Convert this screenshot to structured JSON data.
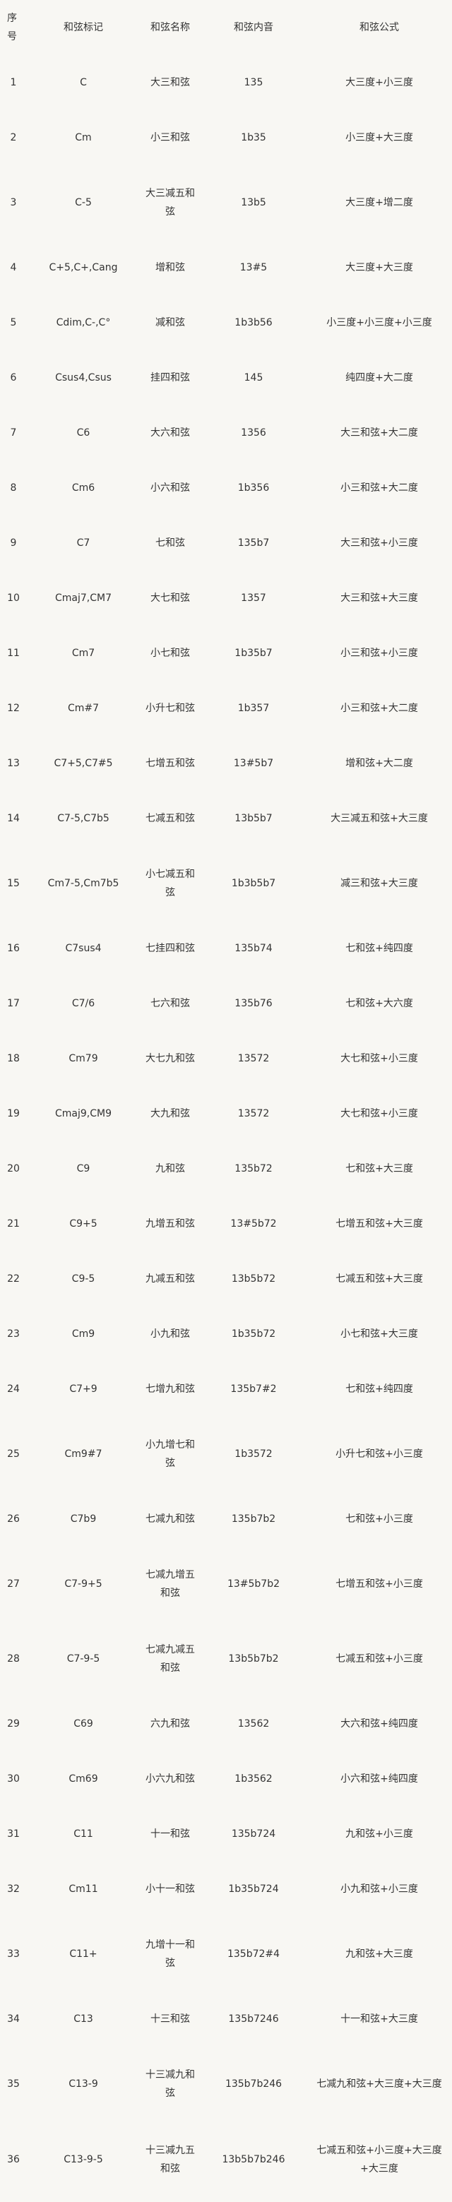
{
  "headers": {
    "num": "序号",
    "mark": "和弦标记",
    "name": "和弦名称",
    "tones": "和弦内音",
    "formula": "和弦公式"
  },
  "rows": [
    {
      "num": "1",
      "mark": "C",
      "name": "大三和弦",
      "tones": "135",
      "formula": "大三度+小三度"
    },
    {
      "num": "2",
      "mark": "Cm",
      "name": "小三和弦",
      "tones": "1b35",
      "formula": "小三度+大三度"
    },
    {
      "num": "3",
      "mark": "C-5",
      "name": "大三减五和弦",
      "tones": "13b5",
      "formula": "大三度+增二度"
    },
    {
      "num": "4",
      "mark": "C+5,C+,Cang",
      "name": "增和弦",
      "tones": "13#5",
      "formula": "大三度+大三度"
    },
    {
      "num": "5",
      "mark": "Cdim,C-,C°",
      "name": "减和弦",
      "tones": "1b3b56",
      "formula": "小三度+小三度+小三度"
    },
    {
      "num": "6",
      "mark": "Csus4,Csus",
      "name": "挂四和弦",
      "tones": "145",
      "formula": "纯四度+大二度"
    },
    {
      "num": "7",
      "mark": "C6",
      "name": "大六和弦",
      "tones": "1356",
      "formula": "大三和弦+大二度"
    },
    {
      "num": "8",
      "mark": "Cm6",
      "name": "小六和弦",
      "tones": "1b356",
      "formula": "小三和弦+大二度"
    },
    {
      "num": "9",
      "mark": "C7",
      "name": "七和弦",
      "tones": "135b7",
      "formula": "大三和弦+小三度"
    },
    {
      "num": "10",
      "mark": "Cmaj7,CM7",
      "name": "大七和弦",
      "tones": "1357",
      "formula": "大三和弦+大三度"
    },
    {
      "num": "11",
      "mark": "Cm7",
      "name": "小七和弦",
      "tones": "1b35b7",
      "formula": "小三和弦+小三度"
    },
    {
      "num": "12",
      "mark": "Cm#7",
      "name": "小升七和弦",
      "tones": "1b357",
      "formula": "小三和弦+大二度"
    },
    {
      "num": "13",
      "mark": "C7+5,C7#5",
      "name": "七增五和弦",
      "tones": "13#5b7",
      "formula": "增和弦+大二度"
    },
    {
      "num": "14",
      "mark": "C7-5,C7b5",
      "name": "七减五和弦",
      "tones": "13b5b7",
      "formula": "大三减五和弦+大三度"
    },
    {
      "num": "15",
      "mark": "Cm7-5,Cm7b5",
      "name": "小七减五和弦",
      "tones": "1b3b5b7",
      "formula": "减三和弦+大三度"
    },
    {
      "num": "16",
      "mark": "C7sus4",
      "name": "七挂四和弦",
      "tones": "135b74",
      "formula": "七和弦+纯四度"
    },
    {
      "num": "17",
      "mark": "C7/6",
      "name": "七六和弦",
      "tones": "135b76",
      "formula": "七和弦+大六度"
    },
    {
      "num": "18",
      "mark": "Cm79",
      "name": "大七九和弦",
      "tones": "13572",
      "formula": "大七和弦+小三度"
    },
    {
      "num": "19",
      "mark": "Cmaj9,CM9",
      "name": "大九和弦",
      "tones": "13572",
      "formula": "大七和弦+小三度"
    },
    {
      "num": "20",
      "mark": "C9",
      "name": "九和弦",
      "tones": "135b72",
      "formula": "七和弦+大三度"
    },
    {
      "num": "21",
      "mark": "C9+5",
      "name": "九增五和弦",
      "tones": "13#5b72",
      "formula": "七增五和弦+大三度"
    },
    {
      "num": "22",
      "mark": "C9-5",
      "name": "九减五和弦",
      "tones": "13b5b72",
      "formula": "七减五和弦+大三度"
    },
    {
      "num": "23",
      "mark": "Cm9",
      "name": "小九和弦",
      "tones": "1b35b72",
      "formula": "小七和弦+大三度"
    },
    {
      "num": "24",
      "mark": "C7+9",
      "name": "七增九和弦",
      "tones": "135b7#2",
      "formula": "七和弦+纯四度"
    },
    {
      "num": "25",
      "mark": "Cm9#7",
      "name": "小九增七和弦",
      "tones": "1b3572",
      "formula": "小升七和弦+小三度"
    },
    {
      "num": "26",
      "mark": "C7b9",
      "name": "七减九和弦",
      "tones": "135b7b2",
      "formula": "七和弦+小三度"
    },
    {
      "num": "27",
      "mark": "C7-9+5",
      "name": "七减九增五和弦",
      "tones": "13#5b7b2",
      "formula": "七增五和弦+小三度"
    },
    {
      "num": "28",
      "mark": "C7-9-5",
      "name": "七减九减五和弦",
      "tones": "13b5b7b2",
      "formula": "七减五和弦+小三度"
    },
    {
      "num": "29",
      "mark": "C69",
      "name": "六九和弦",
      "tones": "13562",
      "formula": "大六和弦+纯四度"
    },
    {
      "num": "30",
      "mark": "Cm69",
      "name": "小六九和弦",
      "tones": "1b3562",
      "formula": "小六和弦+纯四度"
    },
    {
      "num": "31",
      "mark": "C11",
      "name": "十一和弦",
      "tones": "135b724",
      "formula": "九和弦+小三度"
    },
    {
      "num": "32",
      "mark": "Cm11",
      "name": "小十一和弦",
      "tones": "1b35b724",
      "formula": "小九和弦+小三度"
    },
    {
      "num": "33",
      "mark": "C11+",
      "name": "九增十一和弦",
      "tones": "135b72#4",
      "formula": "九和弦+大三度"
    },
    {
      "num": "34",
      "mark": "C13",
      "name": "十三和弦",
      "tones": "135b7246",
      "formula": "十一和弦+大三度"
    },
    {
      "num": "35",
      "mark": "C13-9",
      "name": "十三减九和弦",
      "tones": "135b7b246",
      "formula": "七减九和弦+大三度+大三度"
    },
    {
      "num": "36",
      "mark": "C13-9-5",
      "name": "十三减九五和弦",
      "tones": "13b5b7b246",
      "formula": "七减五和弦+小三度+大三度+大三度"
    }
  ]
}
